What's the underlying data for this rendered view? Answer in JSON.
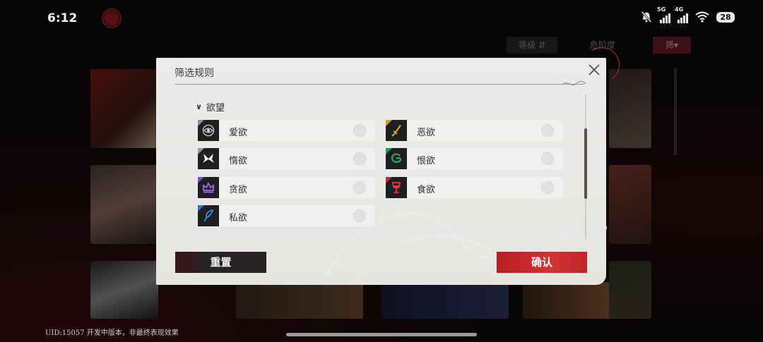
{
  "status_bar": {
    "time": "6:12",
    "signal_1_tag": "5G",
    "signal_2_tag": "4G",
    "battery": "28"
  },
  "background": {
    "top_buttons": [
      "等级 ⇵",
      "危阶度",
      "筛▾"
    ]
  },
  "filter_modal": {
    "title": "筛选规则",
    "section": {
      "label": "欲望",
      "options": [
        {
          "label": "爱欲",
          "icon": "eye-ring-icon",
          "accent": "#8a8fa0"
        },
        {
          "label": "恶欲",
          "icon": "dagger-icon",
          "accent": "#d4a017"
        },
        {
          "label": "惰欲",
          "icon": "butterfly-icon",
          "accent": "#9a9a9a"
        },
        {
          "label": "恨欲",
          "icon": "serpent-icon",
          "accent": "#1f9a4a"
        },
        {
          "label": "贪欲",
          "icon": "crown-icon",
          "accent": "#7a4ad0"
        },
        {
          "label": "食欲",
          "icon": "wine-glass-icon",
          "accent": "#c8282e"
        },
        {
          "label": "私欲",
          "icon": "feather-quill-icon",
          "accent": "#2a7ad0"
        }
      ]
    },
    "reset_label": "重置",
    "confirm_label": "确认"
  },
  "footer": {
    "uid_text": "UID:15057   开发中版本，非最终表现效果"
  },
  "colors": {
    "confirm_red": "#c2242a",
    "modal_bg": "#e9e8e6"
  }
}
